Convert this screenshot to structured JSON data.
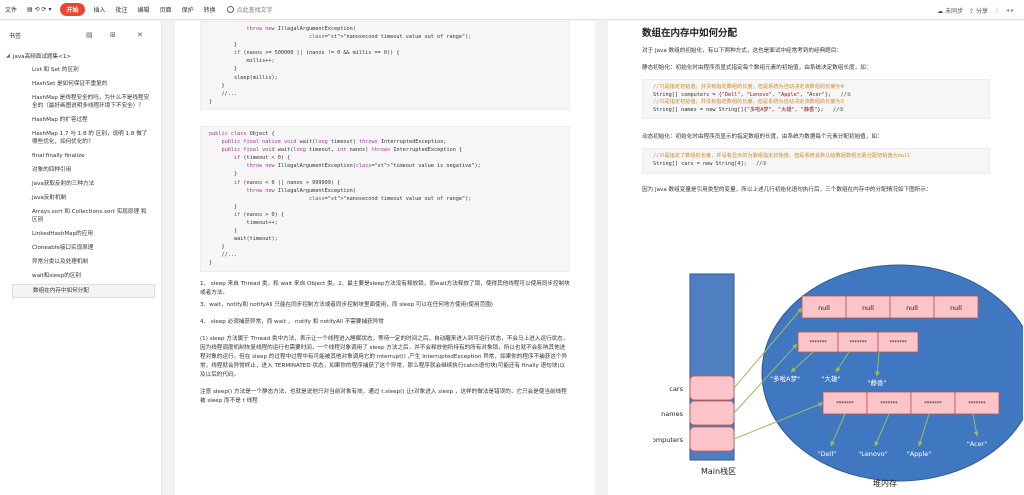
{
  "toolbar": {
    "file": "文件",
    "icons": "▤ ⟲ ⟳ ▾",
    "start": "开始",
    "insert": "插入",
    "annotate": "批注",
    "page_layout": "编辑",
    "page": "页面",
    "protect": "保护",
    "convert": "转换",
    "search": "点此查找文字",
    "sync": "未同步",
    "share": "分享",
    "arrows": "◂ ▸"
  },
  "sidebar": {
    "title": "书签",
    "root": "java高频面试题集<1>",
    "items": [
      "List 和 Set 的区别",
      "HashSet 是如何保证不重复的",
      "HashMap 是线程安全的吗，为什么不是线程安全的（最好画图说明多线程环境下不安全）？",
      "HashMap 的扩容过程",
      "HashMap 1.7 与 1.8 的 区别，说明 1.8 做了哪些优化，如何优化的？",
      "final finally finalize",
      "对象的四种引用",
      "Java获取反射的三种方法",
      "Java反射机制",
      "Arrays.sort 和 Collections.sort 实现原理 和区别",
      "LinkedHashMap的应用",
      "Cloneable接口实现原理",
      "异常分类以及处理机制",
      "wait和sleep的区别",
      "数组在内存中如何分配"
    ]
  },
  "doc1": {
    "code1": [
      "            throw new IllegalArgumentException(",
      "                                \"nanosecond timeout value out of range\");",
      "        }",
      "        if (nanos >= 500000 || (nanos != 0 && millis == 0)) {",
      "            millis++;",
      "        }",
      "        sleep(millis);",
      "    }",
      "    //...",
      "}"
    ],
    "code2": [
      "public class Object {",
      "    public final native void wait(long timeout) throws InterruptedException;",
      "    public final void wait(long timeout, int nanos) throws InterruptedException {",
      "        if (timeout < 0) {",
      "            throw new IllegalArgumentException(\"timeout value is negative\");",
      "        }",
      "        if (nanos < 0 || nanos > 999999) {",
      "            throw new IllegalArgumentException(",
      "                                \"nanosecond timeout value out of range\");",
      "        }",
      "        if (nanos > 0) {",
      "            timeout++;",
      "        }",
      "        wait(timeout);",
      "    }",
      "    //...",
      "}"
    ],
    "p1": "1、 sleep 来自 Thread 类，和 wait 来自 Object 类。2、最主要是sleep方法没有释放锁，而wait方法释放了锁，使得其他线程可以使用同步控制块或者方法。",
    "p2": "3、wait，notify和 notifyAll 只能在同步控制方法或者同步控制块里面使用，而 sleep 可以在任何地方使用(使用范围)",
    "p3": "4、 sleep 必须捕获异常，而 wait ， notify 和 notifyAll 不需要捕获异常",
    "p4": "(1) sleep 方法属于 Thread 类中方法，表示让一个线程进入睡眠状态，等待一定的时间之后，自动醒来进入到可运行状态，不会马上进入运行状态，因为线程调度机制恢复线程的运行也需要时间，一个线程对象调用了 sleep 方法之后，并不会释放他所持有的所有对象锁，所以也就不会影响其他进程对象的运行。但在 sleep 的过程中过程中有可能被其他对象调用它的 interrupt() ,产生 InterruptedException 异常，如果你的程序不捕获这个异常，线程就会异常终止，进入 TERMINATED 状态，如果你的程序捕获了这个异常，那么程序就会继续执行catch语句块(可能还有 finally 语句块)以及以后的代码。",
    "p5": "注意 sleep() 方法是一个静态方法，也就是说他只对当前对象有效，通过 t.sleep() 让t对象进入 sleep ，这样的做法是错误的，它只会是使当前线程被 sleep 而不是 t 线程"
  },
  "doc2": {
    "title": "数组在内存中如何分配",
    "p1": "对于 Java 数组的初始化，有以下两种方式，这也是面试中经常考到的经典题目：",
    "p2": "静态初始化：初始化时由程序员显式指定每个数组元素的初始值，由系统决定数组长度，如：",
    "code1": [
      "//只是指定初始值，并没有指定数组的长度，但是系统为自动决定该数组的长度为4",
      "String[] computers = {\"Dell\", \"Lenovo\", \"Apple\", \"Acer\"};   //①",
      "//只是指定初始值，并没有指定数组的长度，但是系统为自动决定该数组的长度为3",
      "String[] names = new String[]{\"多啦A梦\", \"大雄\", \"静香\"};   //②"
    ],
    "p3": "动态初始化：初始化时由程序员显示的指定数组的长度，由系统为数据每个元素分配初始值，如：",
    "code2": [
      "//只是指定了数组的长度，并没有显示的为数组指定初始值，但是系统会默认给数组数组元素分配初始值为null",
      "String[] cars = new String[4];   //③"
    ],
    "p4": "因为 Java 数组变量是引用类型的变量，所以上述几行初始化语句执行后，三个数组在内存中的分配情况如下图所示："
  },
  "diagram": {
    "stack_label": "Main栈区",
    "heap_label": "堆内存",
    "vars": [
      "cars",
      "names",
      "computers"
    ],
    "null_cells": [
      "null",
      "null",
      "null",
      "null"
    ],
    "names_values": [
      "\"多啦A梦\"",
      "\"大雄\"",
      "\"静香\""
    ],
    "computers_values": [
      "\"Dell\"",
      "\"Lenovo\"",
      "\"Apple\"",
      "\"Acer\""
    ],
    "star": "*******",
    "colors": {
      "stack": "#4f7fc0",
      "heap": "#3f77c1",
      "cell": "#fac4c8",
      "cell_border": "#c0504d",
      "arrow": "#9bbb59"
    }
  }
}
